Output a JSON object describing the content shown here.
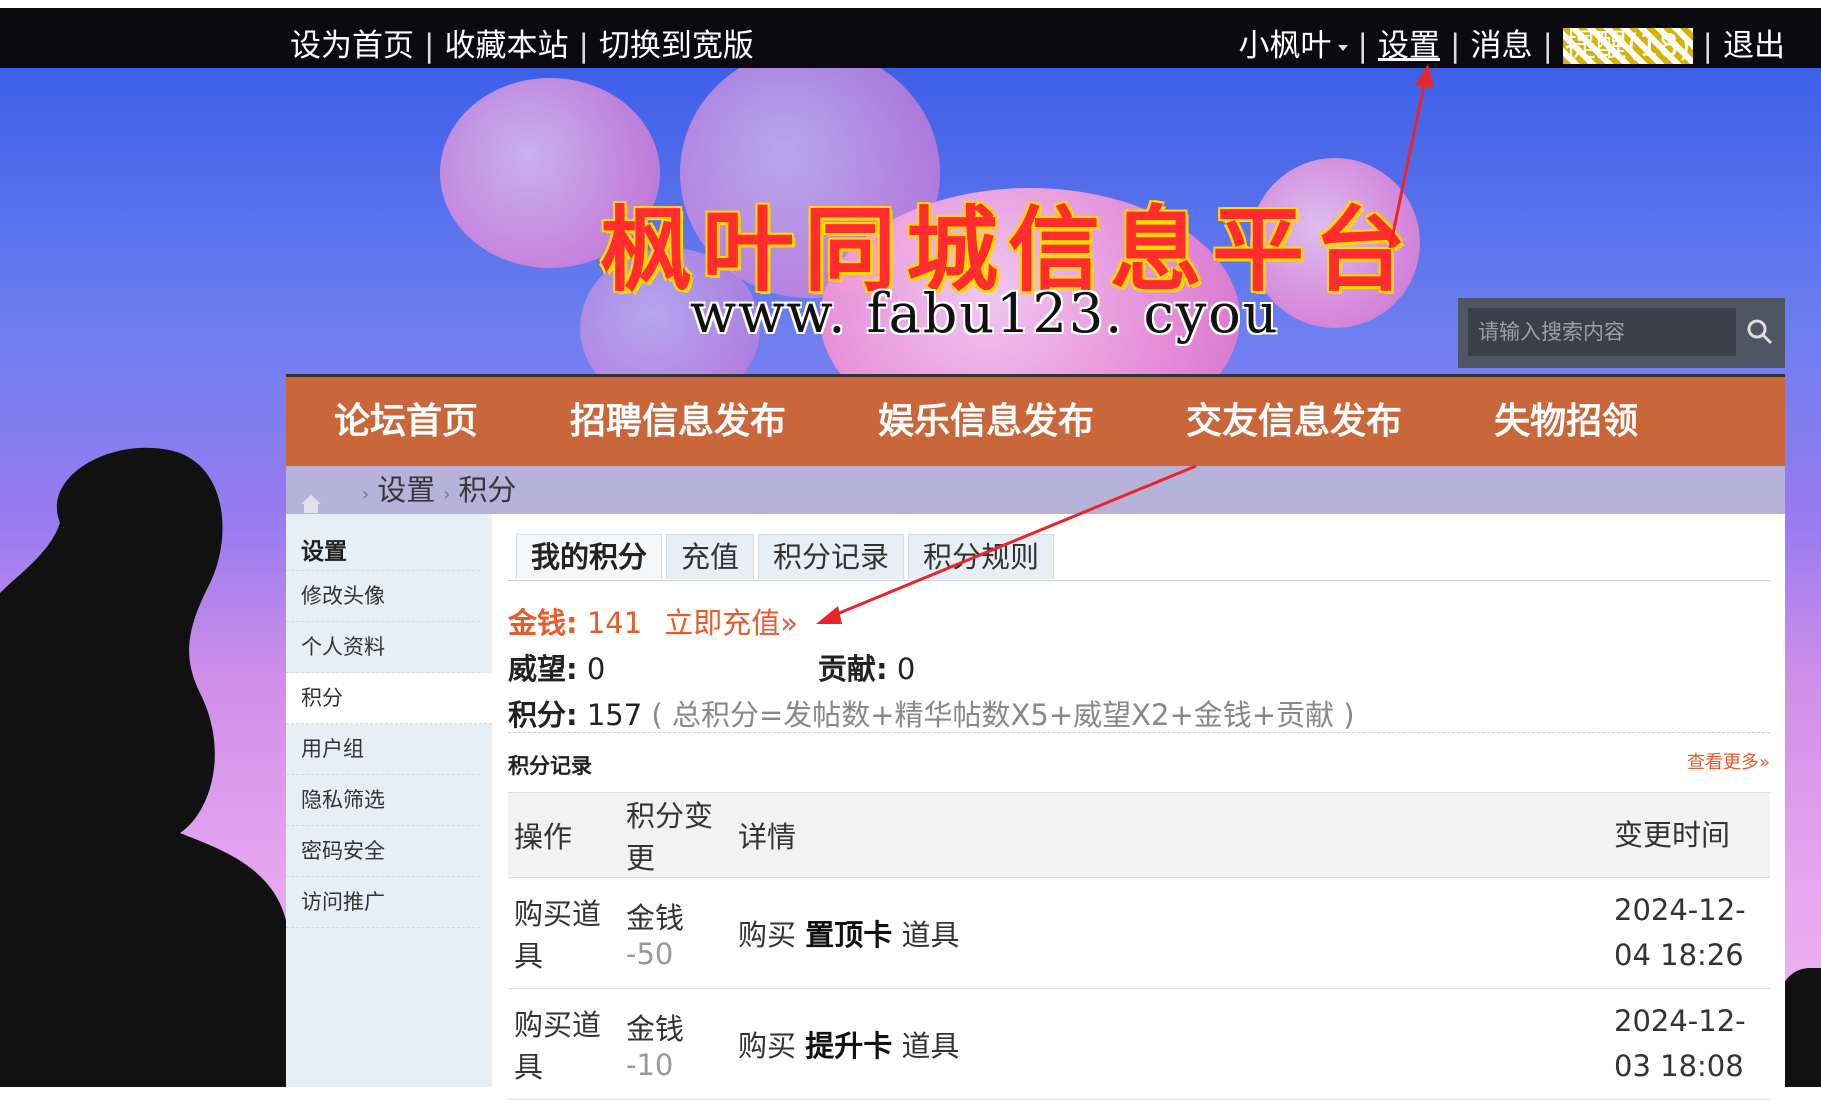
{
  "topbar": {
    "left_links": [
      "设为首页",
      "收藏本站",
      "切换到宽版"
    ],
    "username": "小枫叶",
    "settings": "设置",
    "messages": "消息",
    "remind": "提醒(18)",
    "logout": "退出"
  },
  "banner": {
    "title": "枫叶同城信息平台",
    "url": "www. fabu123. cyou"
  },
  "search": {
    "placeholder": "请输入搜索内容"
  },
  "nav": [
    "论坛首页",
    "招聘信息发布",
    "娱乐信息发布",
    "交友信息发布",
    "失物招领"
  ],
  "breadcrumb": [
    "设置",
    "积分"
  ],
  "sidebar": {
    "heading": "设置",
    "items": [
      "修改头像",
      "个人资料",
      "积分",
      "用户组",
      "隐私筛选",
      "密码安全",
      "访问推广"
    ],
    "active_index": 2
  },
  "tabs": [
    "我的积分",
    "充值",
    "积分记录",
    "积分规则"
  ],
  "credits": {
    "money_label": "金钱:",
    "money_value": "141",
    "recharge_link": "立即充值»",
    "prestige_label": "威望:",
    "prestige_value": "0",
    "contribution_label": "贡献:",
    "contribution_value": "0",
    "points_label": "积分:",
    "points_value": "157",
    "formula": "( 总积分=发帖数+精华帖数X5+威望X2+金钱+贡献 )"
  },
  "records": {
    "title": "积分记录",
    "more": "查看更多»",
    "headers": [
      "操作",
      "积分变更",
      "详情",
      "变更时间"
    ],
    "rows": [
      {
        "action": "购买道具",
        "currency": "金钱",
        "change": "-50",
        "detail_pre": "购买",
        "item": "置顶卡",
        "detail_post": "道具",
        "time": "2024-12-04 18:26"
      },
      {
        "action": "购买道具",
        "currency": "金钱",
        "change": "-10",
        "detail_pre": "购买",
        "item": "提升卡",
        "detail_post": "道具",
        "time": "2024-12-03 18:08"
      }
    ]
  },
  "colors": {
    "nav_bg": "#c9663a",
    "accent": "#e85b2a",
    "topbar_bg": "#0b0b0f"
  }
}
